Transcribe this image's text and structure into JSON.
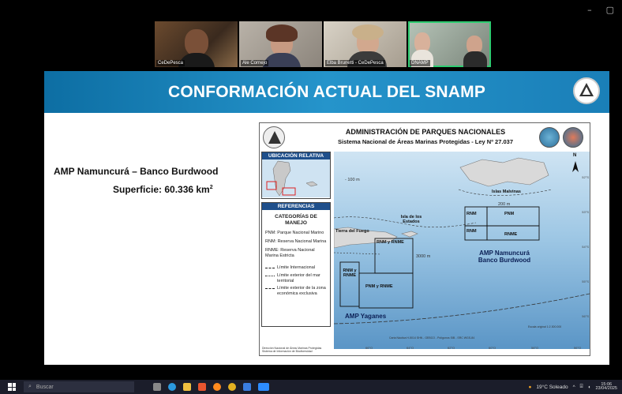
{
  "window_controls": {
    "minimize": "–",
    "restore": "▢"
  },
  "participants": [
    {
      "label": "CeDePesca"
    },
    {
      "label": "Ale Cornejo"
    },
    {
      "label": "Elba Brunetti - CeDePesca"
    },
    {
      "label": "DNAMP"
    }
  ],
  "slide": {
    "title": "CONFORMACIÓN ACTUAL DEL SNAMP",
    "amp_name": "AMP Namuncurá – Banco Burdwood",
    "surface_label": "Superficie: 60.336 km",
    "surface_sup": "2"
  },
  "map": {
    "header_title": "ADMINISTRACIÓN DE PARQUES NACIONALES",
    "header_subtitle": "Sistema Nacional de Áreas Marinas Protegidas - Ley Nº 27.037",
    "ubicacion_title": "UBICACIÓN RELATIVA",
    "referencias_title": "REFERENCIAS",
    "categorias_title": "CATEGORÍAS DE MANEJO",
    "categorias": [
      "PNM: Parque Nacional Marino",
      "RNM: Reserva Nacional Marina",
      "RNME: Reserva Nacional Marina Estricta"
    ],
    "lines": [
      "Límite Internacional",
      "Límite exterior del mar territorial",
      "Límite exterior de la zona económica exclusiva"
    ],
    "footer_note": "Dirección Nacional de Áreas Marinas Protegidas Sistema de Información de Biodiversidad",
    "labels": {
      "m100": "- 100 m",
      "malvinas": "Islas Malvinas",
      "m200": "200 m",
      "isla_estados": "Isla de los Estados",
      "tierra_fuego": "Tierra del Fuego",
      "rnm1": "RNM",
      "pnm1": "PNM",
      "rnm2": "RNM",
      "rnme1": "RNME",
      "rnm_rnme1": "RNM y RNME",
      "m3000": "3000 m",
      "namuncura": "AMP Namuncurá Banco Burdwood",
      "rnm_rnme2": "RNM y RNME",
      "pnm_rnme": "PNM y RNME",
      "yaganes": "AMP Yaganes",
      "north": "N",
      "scale": "Escala original 1:2.300.000",
      "sources": "Carta Náutica H-5014 SHN - GEBCO - Polígonos SIB - SRC WGS-84",
      "lon": [
        "66°O",
        "64°O",
        "62°O",
        "60°O",
        "58°O",
        "56°O"
      ],
      "lat": [
        "52°S",
        "53°S",
        "54°S",
        "55°S",
        "56°S"
      ]
    }
  },
  "taskbar": {
    "search_placeholder": "Buscar",
    "weather": "19°C  Soleado",
    "time": "15:06",
    "date": "23/04/2025"
  },
  "colors": {
    "banner": "#1a82bd",
    "ocean": "#7fb2d8",
    "panel_header": "#1f4f8b",
    "active_speaker": "#2ecc71"
  }
}
